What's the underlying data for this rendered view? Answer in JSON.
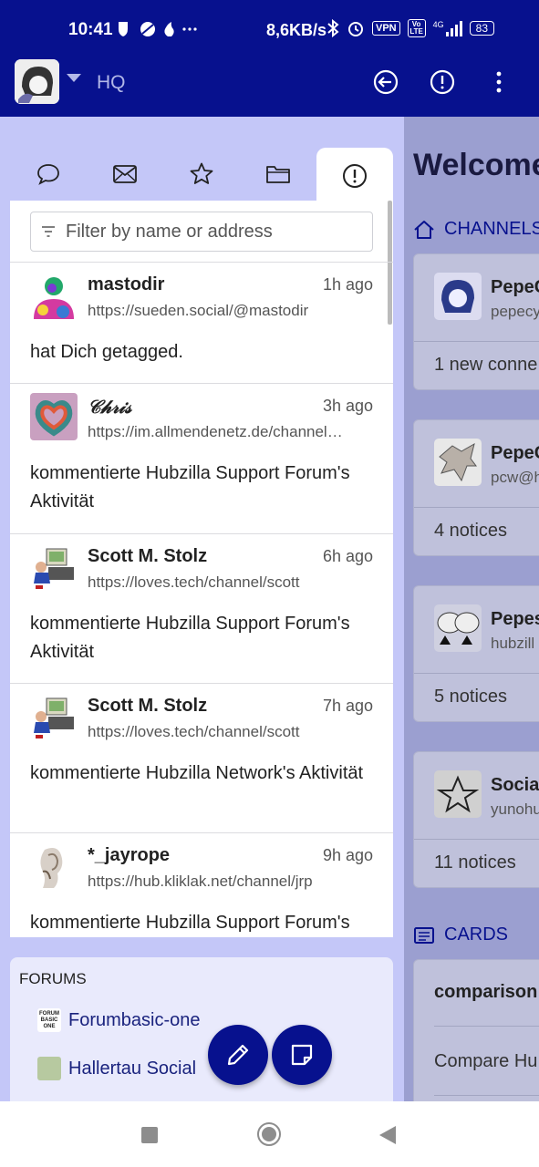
{
  "status_bar": {
    "time": "10:41",
    "speed": "8,6KB/s",
    "vpn": "VPN",
    "volte": "Vo LTE",
    "network": "4G",
    "battery": "83"
  },
  "app_bar": {
    "title": "HQ"
  },
  "tabs": [
    {
      "icon": "chat-bubble-icon"
    },
    {
      "icon": "envelope-icon"
    },
    {
      "icon": "star-icon"
    },
    {
      "icon": "folder-icon"
    },
    {
      "icon": "alert-icon",
      "active": true
    }
  ],
  "filter": {
    "placeholder": "Filter by name or address"
  },
  "notifications": [
    {
      "name": "mastodir",
      "time": "1h ago",
      "url": "https://sueden.social/@mastodir",
      "text": "hat Dich getagged."
    },
    {
      "name": "𝒞𝒽𝓇𝒾𝓈",
      "time": "3h ago",
      "url": "https://im.allmendenetz.de/channel…",
      "text": "kommentierte Hubzilla Support Forum's Aktivität"
    },
    {
      "name": "Scott M. Stolz",
      "time": "6h ago",
      "url": "https://loves.tech/channel/scott",
      "text": "kommentierte Hubzilla Support Forum's Aktivität"
    },
    {
      "name": "Scott M. Stolz",
      "time": "7h ago",
      "url": "https://loves.tech/channel/scott",
      "text": "kommentierte Hubzilla Network's Aktivität"
    },
    {
      "name": "*_jayrope",
      "time": "9h ago",
      "url": "https://hub.kliklak.net/channel/jrp",
      "text": "kommentierte Hubzilla Support Forum's"
    }
  ],
  "forums": {
    "heading": "FORUMS",
    "items": [
      {
        "label": "Forumbasic-one",
        "icon_text": "FORUM BASIC ONE"
      },
      {
        "label": "Hallertau Social"
      }
    ]
  },
  "right": {
    "welcome": "Welcome",
    "channels_heading": "CHANNELS",
    "channels": [
      {
        "name": "PepeC",
        "sub": "pepecy",
        "footer": "1 new conne"
      },
      {
        "name": "PepeC",
        "sub": "pcw@h",
        "footer": "4 notices"
      },
      {
        "name": "Pepes",
        "sub": "hubzill",
        "footer": "5 notices"
      },
      {
        "name": "Socia",
        "sub": "yunohu",
        "footer": "11 notices"
      }
    ],
    "cards_heading": "CARDS",
    "cards": [
      {
        "title": "comparison"
      },
      {
        "text": "Compare Hu"
      }
    ]
  }
}
